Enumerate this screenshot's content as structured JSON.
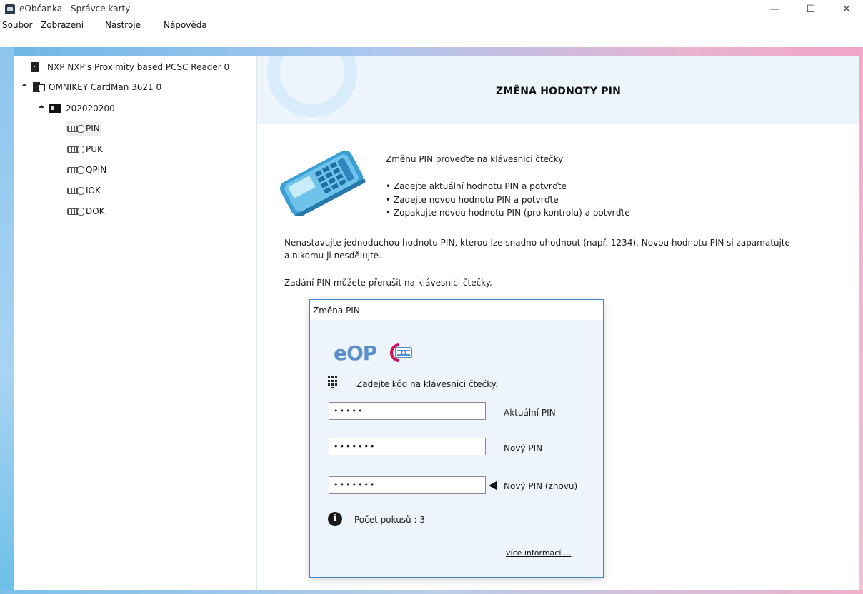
{
  "window": {
    "title": "eObčanka - Správce karty",
    "minimize_glyph": "—",
    "maximize_glyph": "☐",
    "close_glyph": "✕"
  },
  "menu": [
    "Soubor",
    "Zobrazení",
    "Nástroje",
    "Nápověda"
  ],
  "tree": {
    "readers": [
      {
        "label": "NXP NXP's Proximity based PCSC Reader 0"
      },
      {
        "label": "OMNIKEY CardMan 3621 0"
      }
    ],
    "card": {
      "label": "202020200"
    },
    "items": [
      {
        "label": "PIN",
        "selected": true
      },
      {
        "label": "PUK"
      },
      {
        "label": "QPIN"
      },
      {
        "label": "IOK"
      },
      {
        "label": "DOK"
      }
    ]
  },
  "main": {
    "header_title": "ZMĚNA HODNOTY PIN",
    "instruction_title": "Změnu PIN proveďte na klávesnici čtečky:",
    "steps": [
      "• Zadejte aktuální hodnotu PIN a potvrďte",
      "• Zadejte novou hodnotu PIN a potvrďte",
      "• Zopakujte novou hodnotu PIN (pro kontrolu) a potvrďte"
    ],
    "warning_line1": "Nenastavujte jednoduchou hodnotu PIN, kterou lze snadno uhodnout (např. 1234). Novou hodnotu PIN si zapamatujte",
    "warning_line2": "a nikomu ji nesdělujte.",
    "cancel_note": "Zadání PIN můžete přerušit na klávesnici čtečky."
  },
  "dialog": {
    "title": "Změna PIN",
    "logo_text": "eOP",
    "prompt": "Zadejte kód na klávesnici čtečky.",
    "fields": [
      {
        "value": "•••••",
        "label": "Aktuální PIN"
      },
      {
        "value": "•••••••",
        "label": "Nový PIN"
      },
      {
        "value": "•••••••",
        "label": "Nový PIN (znovu)"
      }
    ],
    "attempts": "Počet pokusů : 3",
    "more_info": "více informací ..."
  },
  "colors": {
    "accent_blue": "#3e86d2",
    "logo_blue": "#5b8fcb",
    "logo_magenta": "#d0105a",
    "header_band": "#ecf5fc"
  }
}
